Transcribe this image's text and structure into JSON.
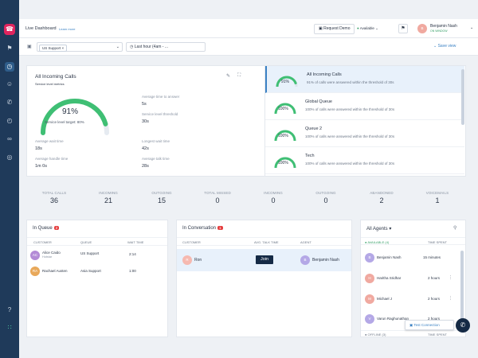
{
  "topbar": {
    "title": "Live Dashboard",
    "learn_more": "Learn more",
    "request_demo": "Request Demo",
    "status": "Available",
    "user_name": "Benjamin Nash",
    "user_sub": "ON WINDOW"
  },
  "filters": {
    "queue_chip": "US Support",
    "time_range": "Last hour (4am - ...",
    "save_view": "Save view"
  },
  "all_incoming": {
    "title": "All Incoming Calls",
    "subtitle": "Service level metrics",
    "gauge_value": "91%",
    "gauge_fraction": 0.91,
    "target_label": "Service level target: 80%",
    "metrics": [
      {
        "label": "Average wait time",
        "value": "18s"
      },
      {
        "label": "Average handle time",
        "value": "1m 0s"
      },
      {
        "label": "Average time to answer",
        "value": "5s"
      },
      {
        "label": "Service level threshold",
        "value": "30s"
      },
      {
        "label": "Longest wait time",
        "value": "42s"
      },
      {
        "label": "Average talk time",
        "value": "28s"
      }
    ]
  },
  "queues": [
    {
      "name": "All Incoming Calls",
      "pct": "91%",
      "fraction": 0.91,
      "desc": "91% of calls were answered within the threshold of 30s",
      "active": true
    },
    {
      "name": "Global Queue",
      "pct": "100%",
      "fraction": 1.0,
      "desc": "100% of calls were answered within the threshold of 30s",
      "active": false
    },
    {
      "name": "Queue 2",
      "pct": "100%",
      "fraction": 1.0,
      "desc": "100% of calls were answered within the threshold of 30s",
      "active": false
    },
    {
      "name": "Tech",
      "pct": "100%",
      "fraction": 1.0,
      "desc": "100% of calls were answered within the threshold of 30s",
      "active": false
    }
  ],
  "stats": [
    {
      "label": "TOTAL CALLS",
      "value": "36"
    },
    {
      "label": "INCOMING",
      "value": "21"
    },
    {
      "label": "OUTGOING",
      "value": "15"
    },
    {
      "label": "TOTAL MISSED",
      "value": "0"
    },
    {
      "label": "INCOMING",
      "value": "0"
    },
    {
      "label": "OUTGOING",
      "value": "0"
    },
    {
      "label": "ABANDONED",
      "value": "2"
    },
    {
      "label": "VOICEMAILS",
      "value": "1"
    }
  ],
  "in_queue": {
    "title": "In Queue",
    "count": "2",
    "headers": [
      "CUSTOMER",
      "QUEUE",
      "WAIT TIME"
    ],
    "rows": [
      {
        "initials": "AC",
        "name": "Alice Caido",
        "sub": "Hotstar",
        "queue": "US Support",
        "wait": "2:14",
        "color": "#b38bd6"
      },
      {
        "initials": "RA",
        "name": "Rachael Austen",
        "sub": "",
        "queue": "Asia Support",
        "wait": "1:00",
        "color": "#e8a85a"
      }
    ]
  },
  "in_conversation": {
    "title": "In Conversation",
    "count": "1",
    "headers": [
      "CUSTOMER",
      "AVG. TALK TIME",
      "AGENT"
    ],
    "rows": [
      {
        "initials": "R",
        "name": "Ron",
        "action": "Join",
        "agent_initials": "B",
        "agent": "Benjamin Nash"
      }
    ]
  },
  "agents": {
    "title": "All Agents",
    "available_header": "AVAILABLE (4)",
    "time_header": "TIME SPENT",
    "rows": [
      {
        "initials": "B",
        "name": "Benjamin Nash",
        "time": "15 minutes",
        "color": "#b4a8e6"
      },
      {
        "initials": "H",
        "name": "Haritha Sridhar",
        "time": "2 hours",
        "color": "#f0a9a0"
      },
      {
        "initials": "M",
        "name": "Michael J",
        "time": "2 hours",
        "color": "#f0a9a0"
      },
      {
        "initials": "V",
        "name": "Varun Raghunathan",
        "time": "2 hours",
        "color": "#b4a8e6"
      }
    ],
    "offline_header": "OFFLINE (3)",
    "offline_time_header": "TIME SPENT",
    "test_connection": "Test Connection"
  }
}
